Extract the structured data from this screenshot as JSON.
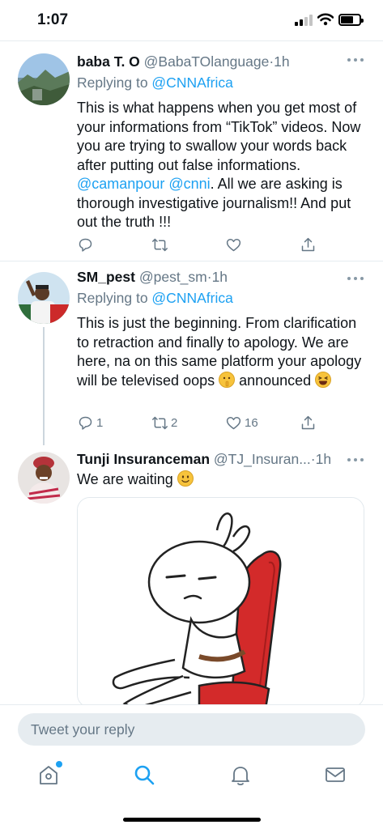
{
  "status_bar": {
    "time": "1:07"
  },
  "tweets": [
    {
      "name": "baba T. O",
      "handle": "@BabaTOlanguage",
      "dot": "·",
      "time": "1h",
      "replying_prefix": "Replying to ",
      "replying_to": "@CNNAfrica",
      "text_1": "This is what happens when you get most of your informations from “TikTok” videos. Now you are trying to swallow your words back after putting out false informations. ",
      "mention_1": "@camanpour",
      "mention_2": "@cnni",
      "text_2": ". All we are asking is thorough investigative journalism!! And put out the truth !!!",
      "reply_count": "",
      "retweet_count": "",
      "like_count": ""
    },
    {
      "name": "SM_pest",
      "handle": "@pest_sm",
      "dot": "·",
      "time": "1h",
      "replying_prefix": "Replying to ",
      "replying_to": "@CNNAfrica",
      "text_1": "This is just the beginning. From clarification to retraction and finally to apology. We are here, na on this same platform your apology will be televised oops ",
      "text_2": " announced ",
      "reply_count": "1",
      "retweet_count": "2",
      "like_count": "16"
    },
    {
      "name": "Tunji Insuranceman",
      "handle": "@TJ_Insuran...",
      "dot": "·",
      "time": "1h",
      "text_1": "We are waiting "
    }
  ],
  "composer": {
    "placeholder": "Tweet your reply"
  },
  "tabbar": {
    "items": [
      "home-icon",
      "search-icon",
      "notifications-icon",
      "messages-icon"
    ]
  },
  "colors": {
    "accent": "#1da1f2",
    "secondary_text": "#657786",
    "divider": "#e6ecf0",
    "reply_box": "#e6ecf0"
  }
}
